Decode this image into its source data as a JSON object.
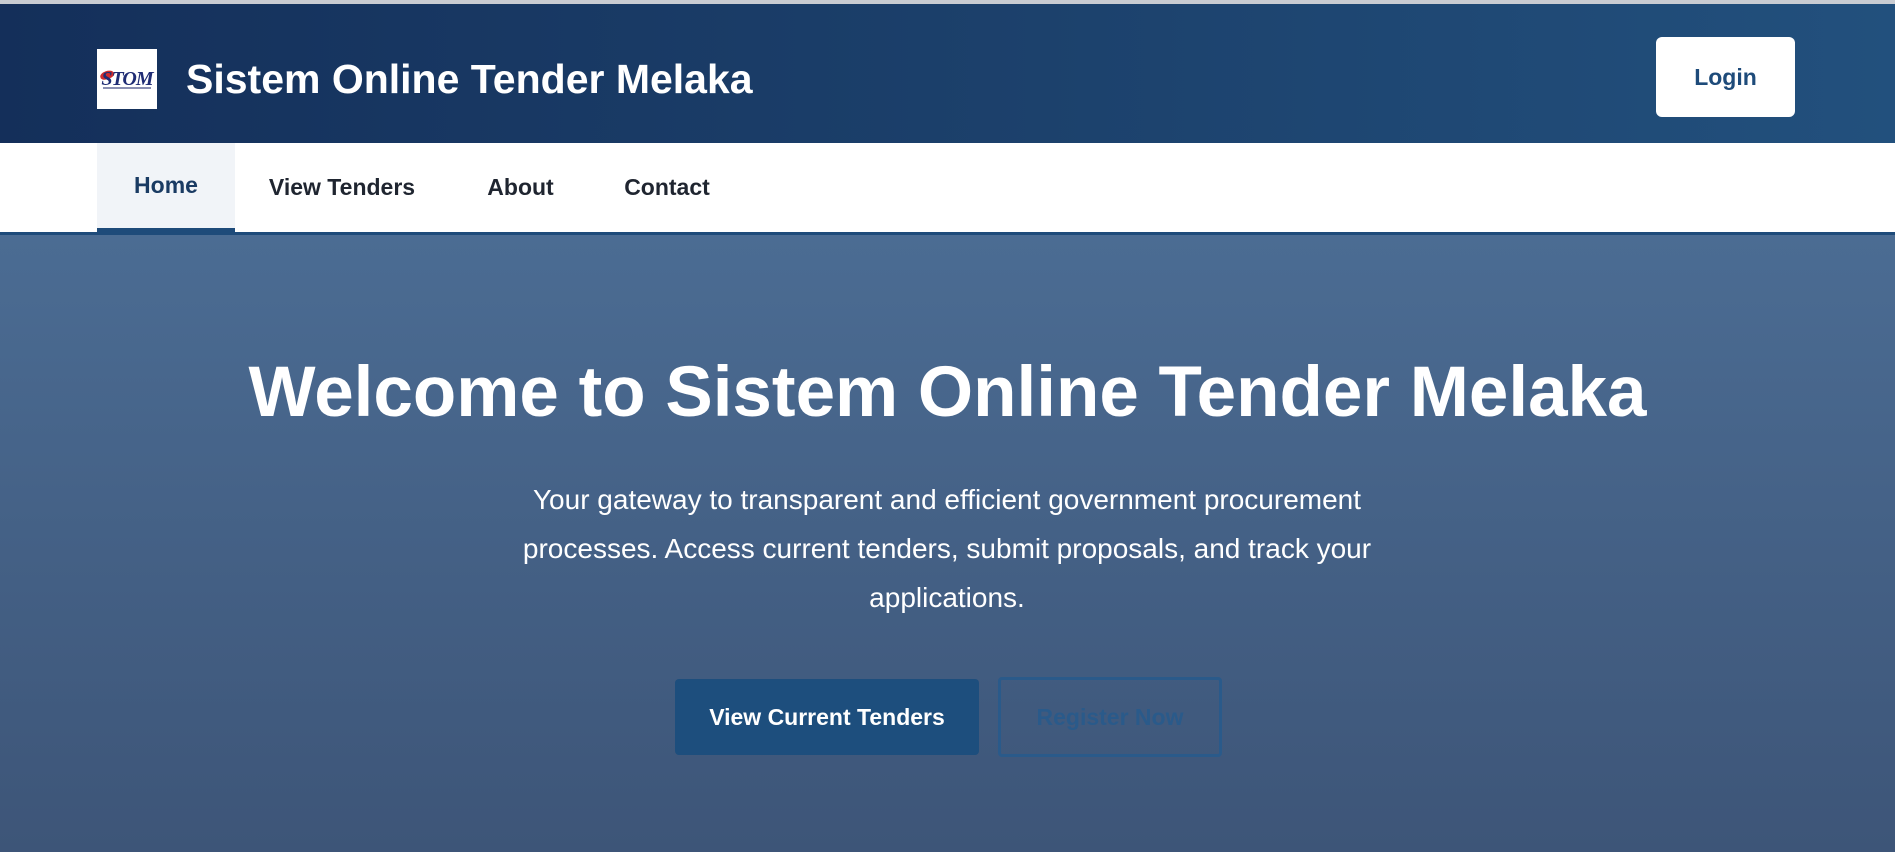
{
  "header": {
    "site_title": "Sistem Online Tender Melaka",
    "logo_text": "STOM",
    "login_label": "Login"
  },
  "nav": {
    "items": [
      {
        "label": "Home",
        "active": true
      },
      {
        "label": "View Tenders",
        "active": false
      },
      {
        "label": "About",
        "active": false
      },
      {
        "label": "Contact",
        "active": false
      }
    ]
  },
  "hero": {
    "title": "Welcome to Sistem Online Tender Melaka",
    "subtitle_lines": [
      "Your gateway to transparent and efficient government procurement",
      "processes. Access current tenders, submit proposals, and track your",
      "applications."
    ],
    "primary_button": "View Current Tenders",
    "secondary_button": "Register Now"
  },
  "colors": {
    "header_bg": "#1c416c",
    "accent": "#1e4b7a",
    "hero_bg": "#4b6c93",
    "primary_button_bg": "#1d4e7d"
  },
  "icons": {
    "logo": "stom-logo"
  }
}
